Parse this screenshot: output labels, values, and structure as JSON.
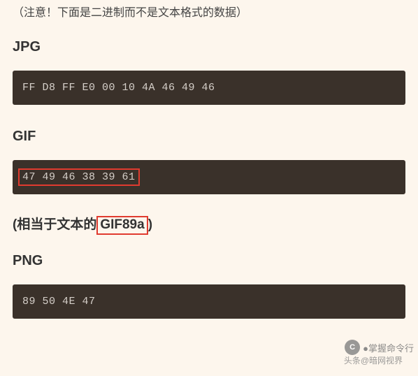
{
  "note_text": "（注意！下面是二进制而不是文本格式的数据）",
  "sections": {
    "jpg": {
      "title": "JPG",
      "hex": "FF D8 FF E0 00 10 4A 46 49 46"
    },
    "gif": {
      "title": "GIF",
      "hex": "47 49 46 38 39 61",
      "subnote_prefix": "(相当于文本的",
      "subnote_boxed": "GIF89a",
      "subnote_suffix": ")"
    },
    "png": {
      "title": "PNG",
      "hex": "89 50 4E 47"
    }
  },
  "watermark": {
    "line1_prefix": "●掌握命令行",
    "line2": "头条@暗网视界"
  }
}
